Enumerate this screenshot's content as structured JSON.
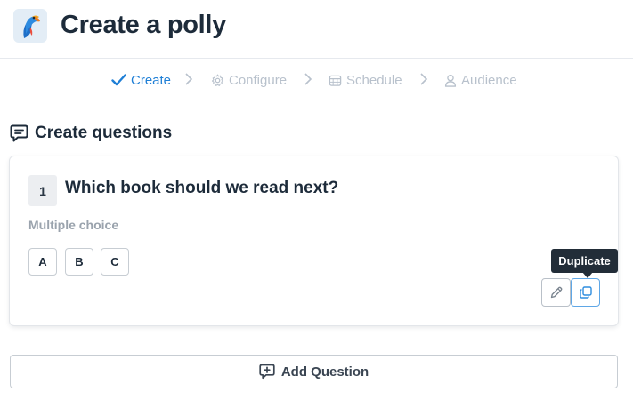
{
  "header": {
    "title": "Create a polly",
    "logo_icon": "parrot-logo-icon"
  },
  "stepper": {
    "steps": [
      {
        "label": "Create",
        "icon": "check-icon",
        "active": true
      },
      {
        "label": "Configure",
        "icon": "gear-icon",
        "active": false
      },
      {
        "label": "Schedule",
        "icon": "calendar-icon",
        "active": false
      },
      {
        "label": "Audience",
        "icon": "user-icon",
        "active": false
      }
    ],
    "active_color": "#1f7fd6",
    "inactive_color": "#b8c1cc"
  },
  "section": {
    "title": "Create questions",
    "icon": "chat-bubble-icon"
  },
  "question": {
    "number": "1",
    "text": "Which book should we read next?",
    "type": "Multiple choice",
    "choices": [
      "A",
      "B",
      "C"
    ],
    "edit_icon": "pencil-icon",
    "duplicate_icon": "copy-icon",
    "tooltip": "Duplicate"
  },
  "add_question": {
    "label": "Add Question",
    "icon": "chat-plus-icon"
  }
}
